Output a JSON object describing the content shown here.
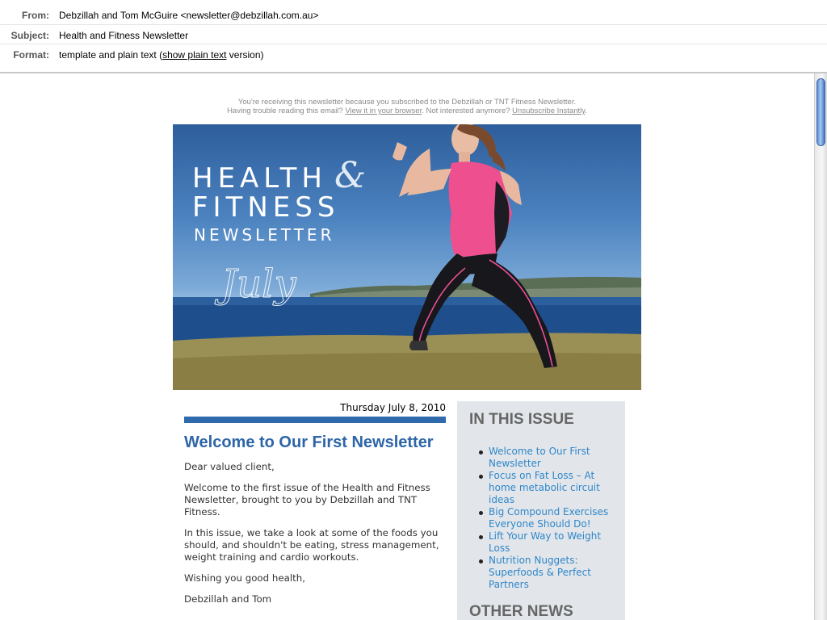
{
  "header": {
    "from_label": "From:",
    "from_value": "Debzillah and Tom McGuire <newsletter@debzillah.com.au>",
    "subject_label": "Subject:",
    "subject_value": "Health and Fitness Newsletter",
    "format_label": "Format:",
    "format_prefix": "template and plain text (",
    "format_link": "show plain text",
    "format_suffix": " version)"
  },
  "notice": {
    "line1": "You're receiving this newsletter because you subscribed to the Debzillah or TNT Fitness Newsletter.",
    "line2_prefix": "Having trouble reading this email? ",
    "view_link": "View it in your browser",
    "line2_mid": ". Not interested anymore? ",
    "unsubscribe_link": "Unsubscribe Instantly",
    "line2_suffix": "."
  },
  "hero": {
    "title_line1": "HEALTH",
    "ampersand": "&",
    "title_line2": "FITNESS",
    "title_line3": "NEWSLETTER",
    "month_script": "July"
  },
  "article": {
    "date": "Thursday July 8, 2010",
    "heading": "Welcome to Our First Newsletter",
    "greeting": "Dear valued client,",
    "para1": "Welcome to the first issue of the Health and Fitness Newsletter, brought to you by Debzillah and TNT Fitness.",
    "para2": "In this issue, we take a look at some of the foods you should, and shouldn't be eating, stress management, weight training and cardio workouts.",
    "closing": "Wishing you good health,",
    "signature": "Debzillah and Tom"
  },
  "sidebar": {
    "heading": "IN THIS ISSUE",
    "items": [
      "Welcome to Our First Newsletter",
      "Focus on Fat Loss – At home metabolic circuit ideas",
      "Big Compound Exercises Everyone Should Do!",
      "Lift Your Way to Weight Loss",
      "Nutrition Nuggets: Superfoods & Perfect Partners"
    ],
    "heading2": "OTHER NEWS"
  },
  "colors": {
    "accent_blue": "#2d65a8",
    "link_blue": "#2f86c9",
    "sidebar_bg": "#e2e6ea"
  }
}
